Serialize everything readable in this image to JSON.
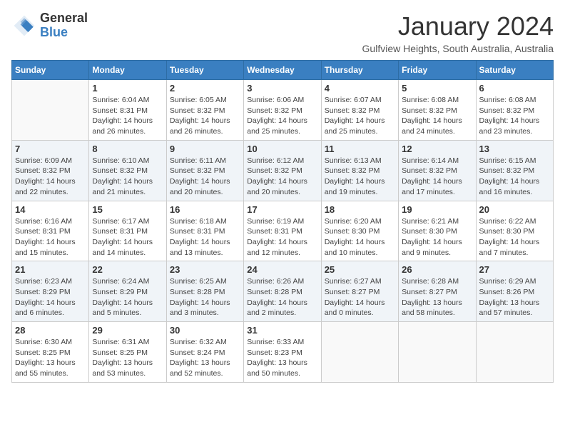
{
  "header": {
    "logo": {
      "general": "General",
      "blue": "Blue"
    },
    "title": "January 2024",
    "subtitle": "Gulfview Heights, South Australia, Australia"
  },
  "calendar": {
    "weekdays": [
      "Sunday",
      "Monday",
      "Tuesday",
      "Wednesday",
      "Thursday",
      "Friday",
      "Saturday"
    ],
    "rows": [
      [
        {
          "num": "",
          "empty": true
        },
        {
          "num": "1",
          "rise": "6:04 AM",
          "set": "8:31 PM",
          "day": "14 hours and 26 minutes"
        },
        {
          "num": "2",
          "rise": "6:05 AM",
          "set": "8:32 PM",
          "day": "14 hours and 26 minutes"
        },
        {
          "num": "3",
          "rise": "6:06 AM",
          "set": "8:32 PM",
          "day": "14 hours and 25 minutes"
        },
        {
          "num": "4",
          "rise": "6:07 AM",
          "set": "8:32 PM",
          "day": "14 hours and 25 minutes"
        },
        {
          "num": "5",
          "rise": "6:08 AM",
          "set": "8:32 PM",
          "day": "14 hours and 24 minutes"
        },
        {
          "num": "6",
          "rise": "6:08 AM",
          "set": "8:32 PM",
          "day": "14 hours and 23 minutes"
        }
      ],
      [
        {
          "num": "7",
          "rise": "6:09 AM",
          "set": "8:32 PM",
          "day": "14 hours and 22 minutes"
        },
        {
          "num": "8",
          "rise": "6:10 AM",
          "set": "8:32 PM",
          "day": "14 hours and 21 minutes"
        },
        {
          "num": "9",
          "rise": "6:11 AM",
          "set": "8:32 PM",
          "day": "14 hours and 20 minutes"
        },
        {
          "num": "10",
          "rise": "6:12 AM",
          "set": "8:32 PM",
          "day": "14 hours and 20 minutes"
        },
        {
          "num": "11",
          "rise": "6:13 AM",
          "set": "8:32 PM",
          "day": "14 hours and 19 minutes"
        },
        {
          "num": "12",
          "rise": "6:14 AM",
          "set": "8:32 PM",
          "day": "14 hours and 17 minutes"
        },
        {
          "num": "13",
          "rise": "6:15 AM",
          "set": "8:32 PM",
          "day": "14 hours and 16 minutes"
        }
      ],
      [
        {
          "num": "14",
          "rise": "6:16 AM",
          "set": "8:31 PM",
          "day": "14 hours and 15 minutes"
        },
        {
          "num": "15",
          "rise": "6:17 AM",
          "set": "8:31 PM",
          "day": "14 hours and 14 minutes"
        },
        {
          "num": "16",
          "rise": "6:18 AM",
          "set": "8:31 PM",
          "day": "14 hours and 13 minutes"
        },
        {
          "num": "17",
          "rise": "6:19 AM",
          "set": "8:31 PM",
          "day": "14 hours and 12 minutes"
        },
        {
          "num": "18",
          "rise": "6:20 AM",
          "set": "8:30 PM",
          "day": "14 hours and 10 minutes"
        },
        {
          "num": "19",
          "rise": "6:21 AM",
          "set": "8:30 PM",
          "day": "14 hours and 9 minutes"
        },
        {
          "num": "20",
          "rise": "6:22 AM",
          "set": "8:30 PM",
          "day": "14 hours and 7 minutes"
        }
      ],
      [
        {
          "num": "21",
          "rise": "6:23 AM",
          "set": "8:29 PM",
          "day": "14 hours and 6 minutes"
        },
        {
          "num": "22",
          "rise": "6:24 AM",
          "set": "8:29 PM",
          "day": "14 hours and 5 minutes"
        },
        {
          "num": "23",
          "rise": "6:25 AM",
          "set": "8:28 PM",
          "day": "14 hours and 3 minutes"
        },
        {
          "num": "24",
          "rise": "6:26 AM",
          "set": "8:28 PM",
          "day": "14 hours and 2 minutes"
        },
        {
          "num": "25",
          "rise": "6:27 AM",
          "set": "8:27 PM",
          "day": "14 hours and 0 minutes"
        },
        {
          "num": "26",
          "rise": "6:28 AM",
          "set": "8:27 PM",
          "day": "13 hours and 58 minutes"
        },
        {
          "num": "27",
          "rise": "6:29 AM",
          "set": "8:26 PM",
          "day": "13 hours and 57 minutes"
        }
      ],
      [
        {
          "num": "28",
          "rise": "6:30 AM",
          "set": "8:25 PM",
          "day": "13 hours and 55 minutes"
        },
        {
          "num": "29",
          "rise": "6:31 AM",
          "set": "8:25 PM",
          "day": "13 hours and 53 minutes"
        },
        {
          "num": "30",
          "rise": "6:32 AM",
          "set": "8:24 PM",
          "day": "13 hours and 52 minutes"
        },
        {
          "num": "31",
          "rise": "6:33 AM",
          "set": "8:23 PM",
          "day": "13 hours and 50 minutes"
        },
        {
          "num": "",
          "empty": true
        },
        {
          "num": "",
          "empty": true
        },
        {
          "num": "",
          "empty": true
        }
      ]
    ]
  }
}
